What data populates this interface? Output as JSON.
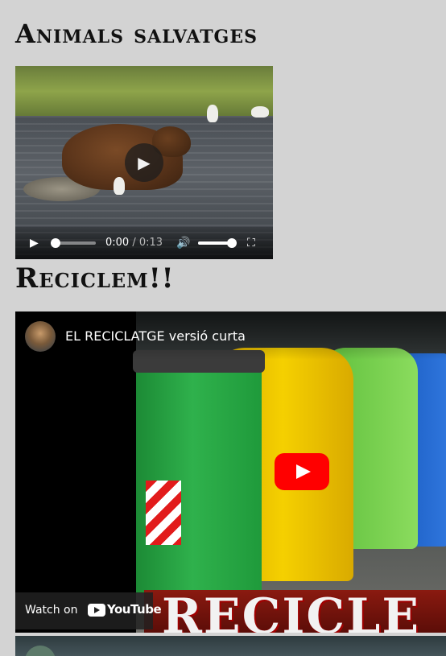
{
  "sections": [
    {
      "heading": "Animals salvatges"
    },
    {
      "heading": "Reciclem!!"
    }
  ],
  "video1": {
    "current_time": "0:00",
    "separator": " / ",
    "duration": "0:13",
    "progress_fraction": 0.0,
    "volume_fraction": 1.0,
    "icons": {
      "play": "play-icon",
      "volume": "volume-icon",
      "fullscreen": "fullscreen-icon"
    }
  },
  "video2": {
    "title": "EL RECICLATGE versió curta",
    "watch_on": "Watch on",
    "platform": "YouTube",
    "overlay_text": "RECICLE",
    "accent_color": "#ff0000"
  }
}
